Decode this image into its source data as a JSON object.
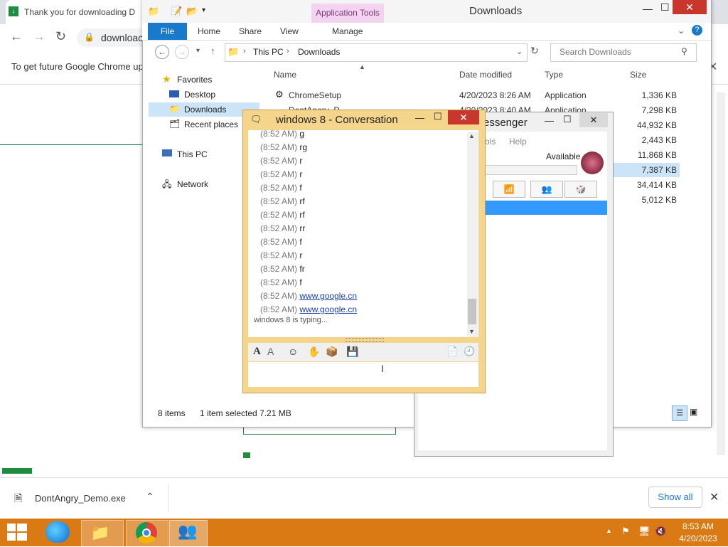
{
  "chrome": {
    "tab_title": "Thank you for downloading D",
    "omnibox_text": "downloac",
    "infobar_text": "To get future Google Chrome up",
    "download_item": "DontAngry_Demo.exe",
    "show_all": "Show all"
  },
  "explorer": {
    "title": "Downloads",
    "app_tools": "Application Tools",
    "tabs": {
      "file": "File",
      "home": "Home",
      "share": "Share",
      "view": "View",
      "manage": "Manage"
    },
    "path": [
      "This PC",
      "Downloads"
    ],
    "search_placeholder": "Search Downloads",
    "nav": {
      "favorites": "Favorites",
      "desktop": "Desktop",
      "downloads": "Downloads",
      "recent": "Recent places",
      "this_pc": "This PC",
      "network": "Network"
    },
    "columns": {
      "name": "Name",
      "date": "Date modified",
      "type": "Type",
      "size": "Size"
    },
    "files": [
      {
        "name": "ChromeSetup",
        "date": "4/20/2023 8:26 AM",
        "type": "Application",
        "size": "1,336 KB"
      },
      {
        "name": "DontAngry_D",
        "date": "4/20/2023 8:40 AM",
        "type": "Application",
        "size": "7,298 KB"
      },
      {
        "size": "44,932 KB"
      },
      {
        "size": "2,443 KB"
      },
      {
        "size": "11,868 KB"
      },
      {
        "size": "7,387 KB"
      },
      {
        "size": "34,414 KB"
      },
      {
        "size": "5,012 KB"
      }
    ],
    "status": {
      "items": "8 items",
      "selected": "1 item selected  7.21 MB"
    }
  },
  "messenger": {
    "title_partial": "essenger",
    "menu_tools": "ols",
    "menu_help": "Help",
    "status": "Available"
  },
  "conversation": {
    "title": "windows 8 - Conversation",
    "messages": [
      {
        "time": "(8:52 AM)",
        "text": "g"
      },
      {
        "time": "(8:52 AM)",
        "text": "rg"
      },
      {
        "time": "(8:52 AM)",
        "text": "r"
      },
      {
        "time": "(8:52 AM)",
        "text": "r"
      },
      {
        "time": "(8:52 AM)",
        "text": "f"
      },
      {
        "time": "(8:52 AM)",
        "text": "rf"
      },
      {
        "time": "(8:52 AM)",
        "text": "rf"
      },
      {
        "time": "(8:52 AM)",
        "text": "rr"
      },
      {
        "time": "(8:52 AM)",
        "text": "f"
      },
      {
        "time": "(8:52 AM)",
        "text": "r"
      },
      {
        "time": "(8:52 AM)",
        "text": "fr"
      },
      {
        "time": "(8:52 AM)",
        "text": "f"
      },
      {
        "time": "(8:52 AM)",
        "text": "www.google.cn",
        "link": true
      },
      {
        "time": "(8:52 AM)",
        "text": "www.google.cn",
        "link": true
      }
    ],
    "typing": "windows 8 is typing..."
  },
  "taskbar": {
    "time": "8:53 AM",
    "date": "4/20/2023"
  },
  "colors": {
    "taskbar": "#d97a14",
    "conv_frame": "#f5d58b",
    "ribbon_file": "#1979ca",
    "selection": "#cce4f7"
  }
}
